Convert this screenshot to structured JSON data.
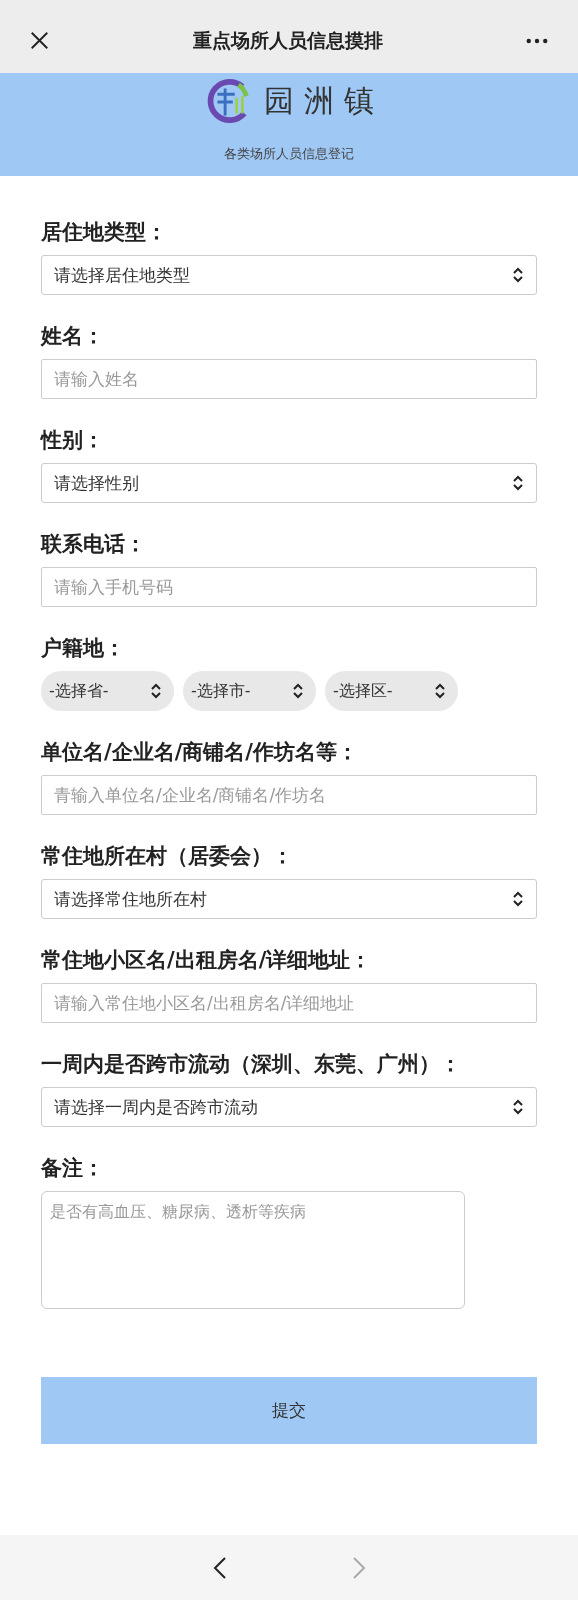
{
  "nav_bar": {
    "title": "重点场所人员信息摸排"
  },
  "banner": {
    "town_name": "园 洲 镇",
    "subtitle": "各类场所人员信息登记"
  },
  "fields": [
    {
      "kind": "select",
      "label": "居住地类型：",
      "value": "请选择居住地类型"
    },
    {
      "kind": "input",
      "label": "姓名：",
      "placeholder": "请输入姓名"
    },
    {
      "kind": "select",
      "label": "性别：",
      "value": "请选择性别"
    },
    {
      "kind": "input",
      "label": "联系电话：",
      "placeholder": "请输入手机号码"
    },
    {
      "kind": "region",
      "label": "户籍地：",
      "options": [
        "-选择省-",
        "-选择市-",
        "-选择区-"
      ]
    },
    {
      "kind": "input",
      "label": "单位名/企业名/商铺名/作坊名等：",
      "placeholder": "青输入单位名/企业名/商铺名/作坊名"
    },
    {
      "kind": "select",
      "label": "常住地所在村（居委会）：",
      "value": "请选择常住地所在村"
    },
    {
      "kind": "input",
      "label": "常住地小区名/出租房名/详细地址：",
      "placeholder": "请输入常住地小区名/出租房名/详细地址"
    },
    {
      "kind": "select",
      "label": "一周内是否跨市流动（深圳、东莞、广州）：",
      "value": "请选择一周内是否跨市流动"
    },
    {
      "kind": "textarea",
      "label": "备注：",
      "placeholder": "是否有高血压、糖尿病、透析等疾病"
    }
  ],
  "submit_button": "提交",
  "bottom_bar": {
    "forward": {
      "disabled": true
    }
  }
}
